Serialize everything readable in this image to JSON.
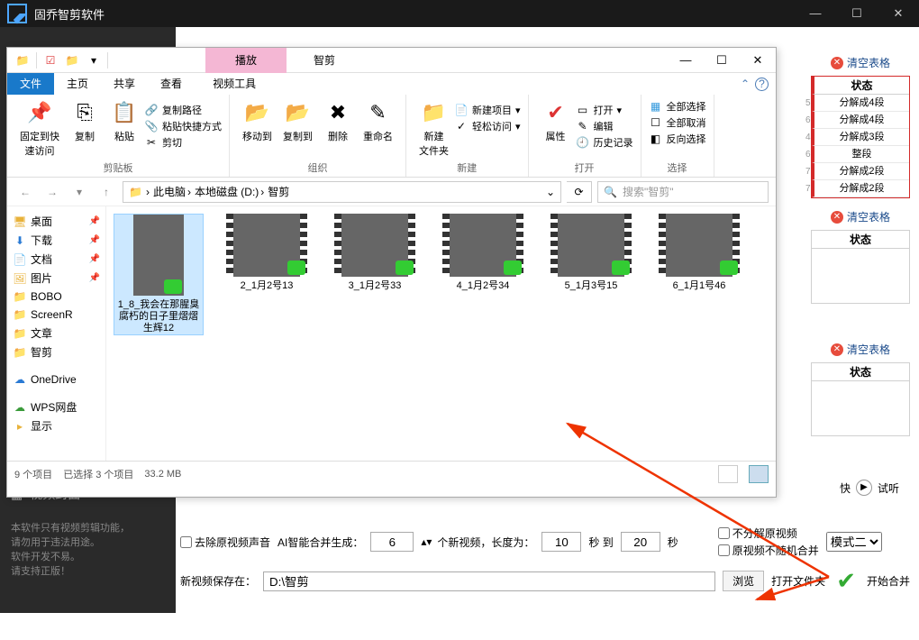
{
  "app": {
    "title": "固乔智剪软件"
  },
  "winbtns": {
    "min": "—",
    "max": "☐",
    "close": "✕"
  },
  "right": {
    "clear": "清空表格",
    "t1": {
      "header": "状态",
      "rows": [
        {
          "n": "5",
          "v": "分解成4段"
        },
        {
          "n": "6",
          "v": "分解成4段"
        },
        {
          "n": "4",
          "v": "分解成3段"
        },
        {
          "n": "6",
          "v": "整段"
        },
        {
          "n": "7",
          "v": "分解成2段"
        },
        {
          "n": "7",
          "v": "分解成2段"
        }
      ]
    },
    "t2": {
      "header": "状态"
    },
    "t3": {
      "header": "状态"
    }
  },
  "explorer": {
    "play_tab": "播放",
    "title": "智剪",
    "tabs": [
      "文件",
      "主页",
      "共享",
      "查看"
    ],
    "tool_tab": "视频工具",
    "ribbon": {
      "pin": "固定到快\n速访问",
      "copy": "复制",
      "paste": "粘贴",
      "copy_path": "复制路径",
      "paste_shortcut": "粘贴快捷方式",
      "cut": "剪切",
      "g1": "剪贴板",
      "move": "移动到",
      "copyto": "复制到",
      "del": "删除",
      "rename": "重命名",
      "g2": "组织",
      "newfolder": "新建\n文件夹",
      "newitem": "新建项目",
      "easy": "轻松访问",
      "g3": "新建",
      "props": "属性",
      "open": "打开",
      "edit": "编辑",
      "history": "历史记录",
      "g4": "打开",
      "selectall": "全部选择",
      "selectnone": "全部取消",
      "invert": "反向选择",
      "g5": "选择"
    },
    "crumbs": [
      "此电脑",
      "本地磁盘 (D:)",
      "智剪"
    ],
    "search_ph": "搜索\"智剪\"",
    "tree": [
      {
        "ic": "🖥",
        "t": "桌面",
        "pin": true
      },
      {
        "ic": "⬇",
        "t": "下载",
        "pin": true,
        "blue": true
      },
      {
        "ic": "📄",
        "t": "文档",
        "pin": true
      },
      {
        "ic": "🖼",
        "t": "图片",
        "pin": true
      },
      {
        "ic": "📁",
        "t": "BOBO"
      },
      {
        "ic": "📁",
        "t": "ScreenR"
      },
      {
        "ic": "📁",
        "t": "文章"
      },
      {
        "ic": "📁",
        "t": "智剪"
      }
    ],
    "tree2": [
      {
        "ic": "☁",
        "t": "OneDrive",
        "blue": true
      }
    ],
    "tree3": [
      {
        "ic": "☁",
        "t": "WPS网盘",
        "grn": true
      },
      {
        "ic": "▸",
        "t": "显示"
      }
    ],
    "files": [
      {
        "name": "1_8_我会在那腥臭腐朽的日子里熠熠生辉12",
        "sel": true,
        "tall": true
      },
      {
        "name": "2_1月2号13"
      },
      {
        "name": "3_1月2号33"
      },
      {
        "name": "4_1月2号34"
      },
      {
        "name": "5_1月3号15"
      },
      {
        "name": "6_1月1号46"
      }
    ],
    "status": {
      "items": "9 个项目",
      "sel": "已选择 3 个项目",
      "size": "33.2 MB"
    }
  },
  "bottom": {
    "cover": "视频封面",
    "note": "本软件只有视频剪辑功能，\n请勿用于违法用途。\n软件开发不易。\n请支持正版！",
    "remove_audio": "去除原视频声音",
    "ai_gen": "AI智能合并生成：",
    "ai_val": "6",
    "new_unit": "个新视频，长度为：",
    "len": "10",
    "sec": "秒 到",
    "len2": "20",
    "sec2": "秒",
    "no_split": "不分解原视频",
    "no_random": "原视频不随机合并",
    "mode": "模式二",
    "save_lbl": "新视频保存在：",
    "save_path": "D:\\智剪",
    "browse": "浏览",
    "open": "打开文件夹",
    "start": "开始合并",
    "speed_fast": "快",
    "try": "试听"
  }
}
